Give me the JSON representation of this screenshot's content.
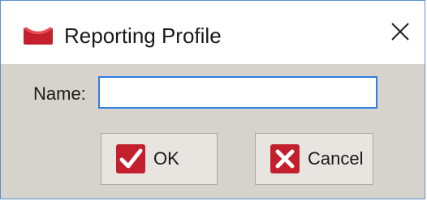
{
  "window": {
    "title": "Reporting Profile",
    "app_icon": "envelope-icon",
    "close_icon": "close-icon"
  },
  "form": {
    "name_label": "Name:",
    "name_value": "",
    "name_placeholder": ""
  },
  "buttons": {
    "ok_label": "OK",
    "ok_icon": "checkmark-icon",
    "cancel_label": "Cancel",
    "cancel_icon": "cross-icon"
  },
  "colors": {
    "accent": "#2f7de1",
    "brand_red": "#c41f2d",
    "window_border": "#5a8fd1",
    "dialog_bg": "#d6d2cc"
  }
}
